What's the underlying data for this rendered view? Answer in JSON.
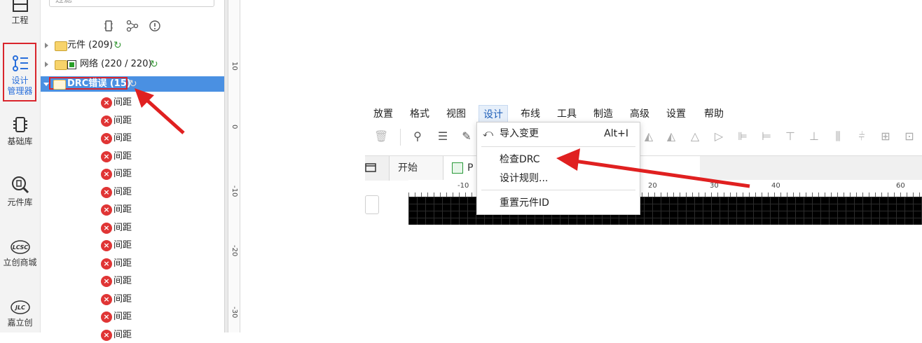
{
  "rail": {
    "items": [
      {
        "label": "工程"
      },
      {
        "label_line1": "设计",
        "label_line2": "管理器"
      },
      {
        "label": "基础库"
      },
      {
        "label": "元件库"
      },
      {
        "label": "立创商城",
        "logo": "LCSC"
      },
      {
        "label": "嘉立创",
        "logo": "JLC"
      }
    ]
  },
  "tree": {
    "search_placeholder": "过滤",
    "rows": [
      {
        "label": "元件 (209)"
      },
      {
        "label": "网络 (220 / 220)"
      },
      {
        "label": "DRC错误 (15)"
      }
    ],
    "errors": [
      "间距",
      "间距",
      "间距",
      "间距",
      "间距",
      "间距",
      "间距",
      "间距",
      "间距",
      "间距",
      "间距",
      "间距",
      "间距",
      "间距"
    ]
  },
  "vruler": {
    "ticks": [
      "10",
      "0",
      "-10",
      "-20",
      "-30"
    ]
  },
  "menubar": {
    "items": [
      "放置",
      "格式",
      "视图",
      "设计",
      "布线",
      "工具",
      "制造",
      "高级",
      "设置",
      "帮助"
    ]
  },
  "dropdown": {
    "import_changes": "导入变更",
    "import_shortcut": "Alt+I",
    "check_drc": "检查DRC",
    "design_rules": "设计规则...",
    "reset_ids": "重置元件ID"
  },
  "tabs": {
    "start": "开始",
    "pcb_prefix": "P"
  },
  "hruler": {
    "ticks": [
      "-10",
      "20",
      "30",
      "40",
      "60"
    ]
  },
  "colors": {
    "highlight": "#d9252c",
    "selection": "#4a90e2",
    "accent": "#2a6fdb"
  }
}
